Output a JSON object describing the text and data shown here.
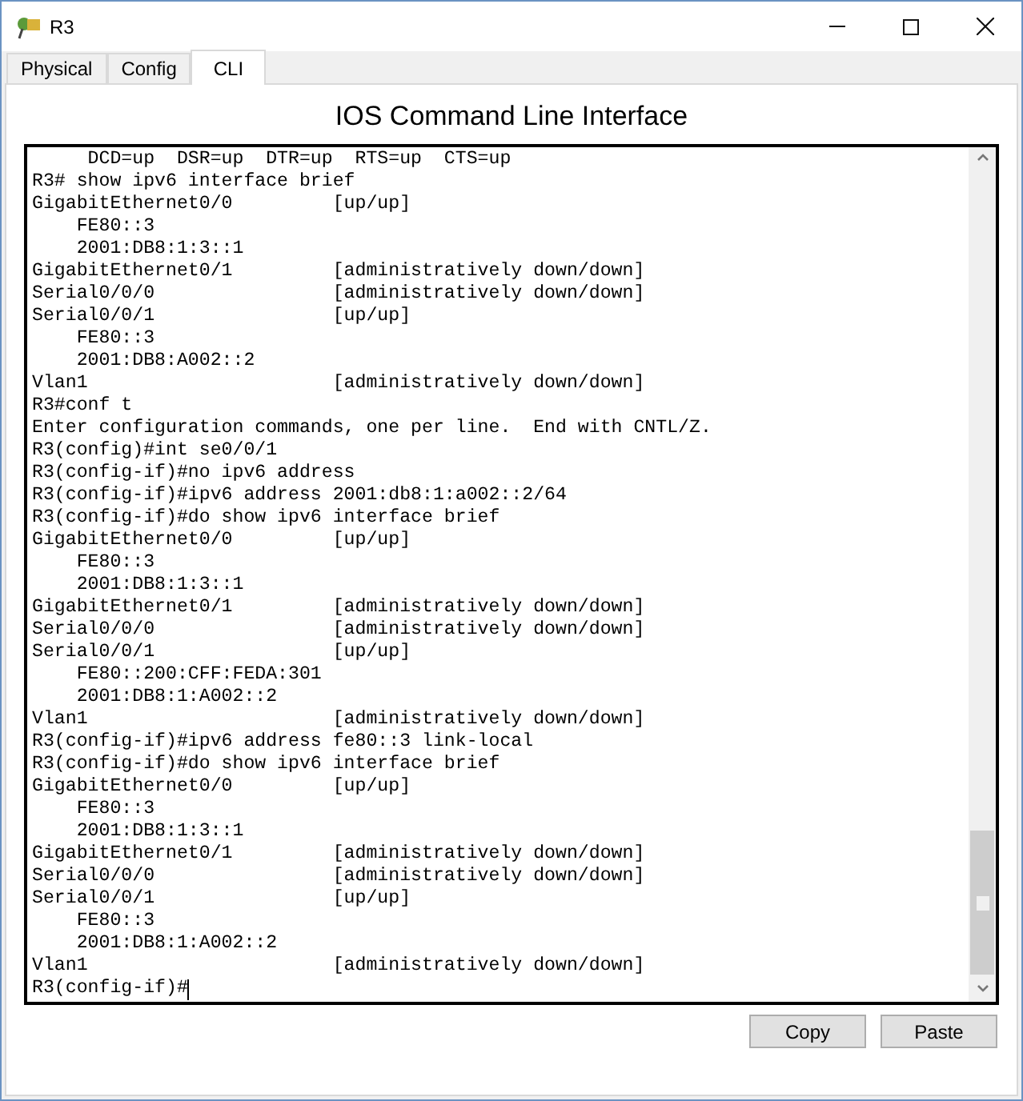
{
  "window": {
    "title": "R3"
  },
  "tabs": [
    {
      "label": "Physical",
      "selected": false
    },
    {
      "label": "Config",
      "selected": false
    },
    {
      "label": "CLI",
      "selected": true
    }
  ],
  "heading": "IOS Command Line Interface",
  "terminal": {
    "lines": [
      "     DCD=up  DSR=up  DTR=up  RTS=up  CTS=up",
      "R3# show ipv6 interface brief",
      "GigabitEthernet0/0         [up/up]",
      "    FE80::3",
      "    2001:DB8:1:3::1",
      "GigabitEthernet0/1         [administratively down/down]",
      "Serial0/0/0                [administratively down/down]",
      "Serial0/0/1                [up/up]",
      "    FE80::3",
      "    2001:DB8:A002::2",
      "Vlan1                      [administratively down/down]",
      "R3#conf t",
      "Enter configuration commands, one per line.  End with CNTL/Z.",
      "R3(config)#int se0/0/1",
      "R3(config-if)#no ipv6 address",
      "R3(config-if)#ipv6 address 2001:db8:1:a002::2/64",
      "R3(config-if)#do show ipv6 interface brief",
      "GigabitEthernet0/0         [up/up]",
      "    FE80::3",
      "    2001:DB8:1:3::1",
      "GigabitEthernet0/1         [administratively down/down]",
      "Serial0/0/0                [administratively down/down]",
      "Serial0/0/1                [up/up]",
      "    FE80::200:CFF:FEDA:301",
      "    2001:DB8:1:A002::2",
      "Vlan1                      [administratively down/down]",
      "R3(config-if)#ipv6 address fe80::3 link-local",
      "R3(config-if)#do show ipv6 interface brief",
      "GigabitEthernet0/0         [up/up]",
      "    FE80::3",
      "    2001:DB8:1:3::1",
      "GigabitEthernet0/1         [administratively down/down]",
      "Serial0/0/0                [administratively down/down]",
      "Serial0/0/1                [up/up]",
      "    FE80::3",
      "    2001:DB8:1:A002::2",
      "Vlan1                      [administratively down/down]",
      "R3(config-if)#"
    ]
  },
  "buttons": [
    "Copy",
    "Paste"
  ]
}
